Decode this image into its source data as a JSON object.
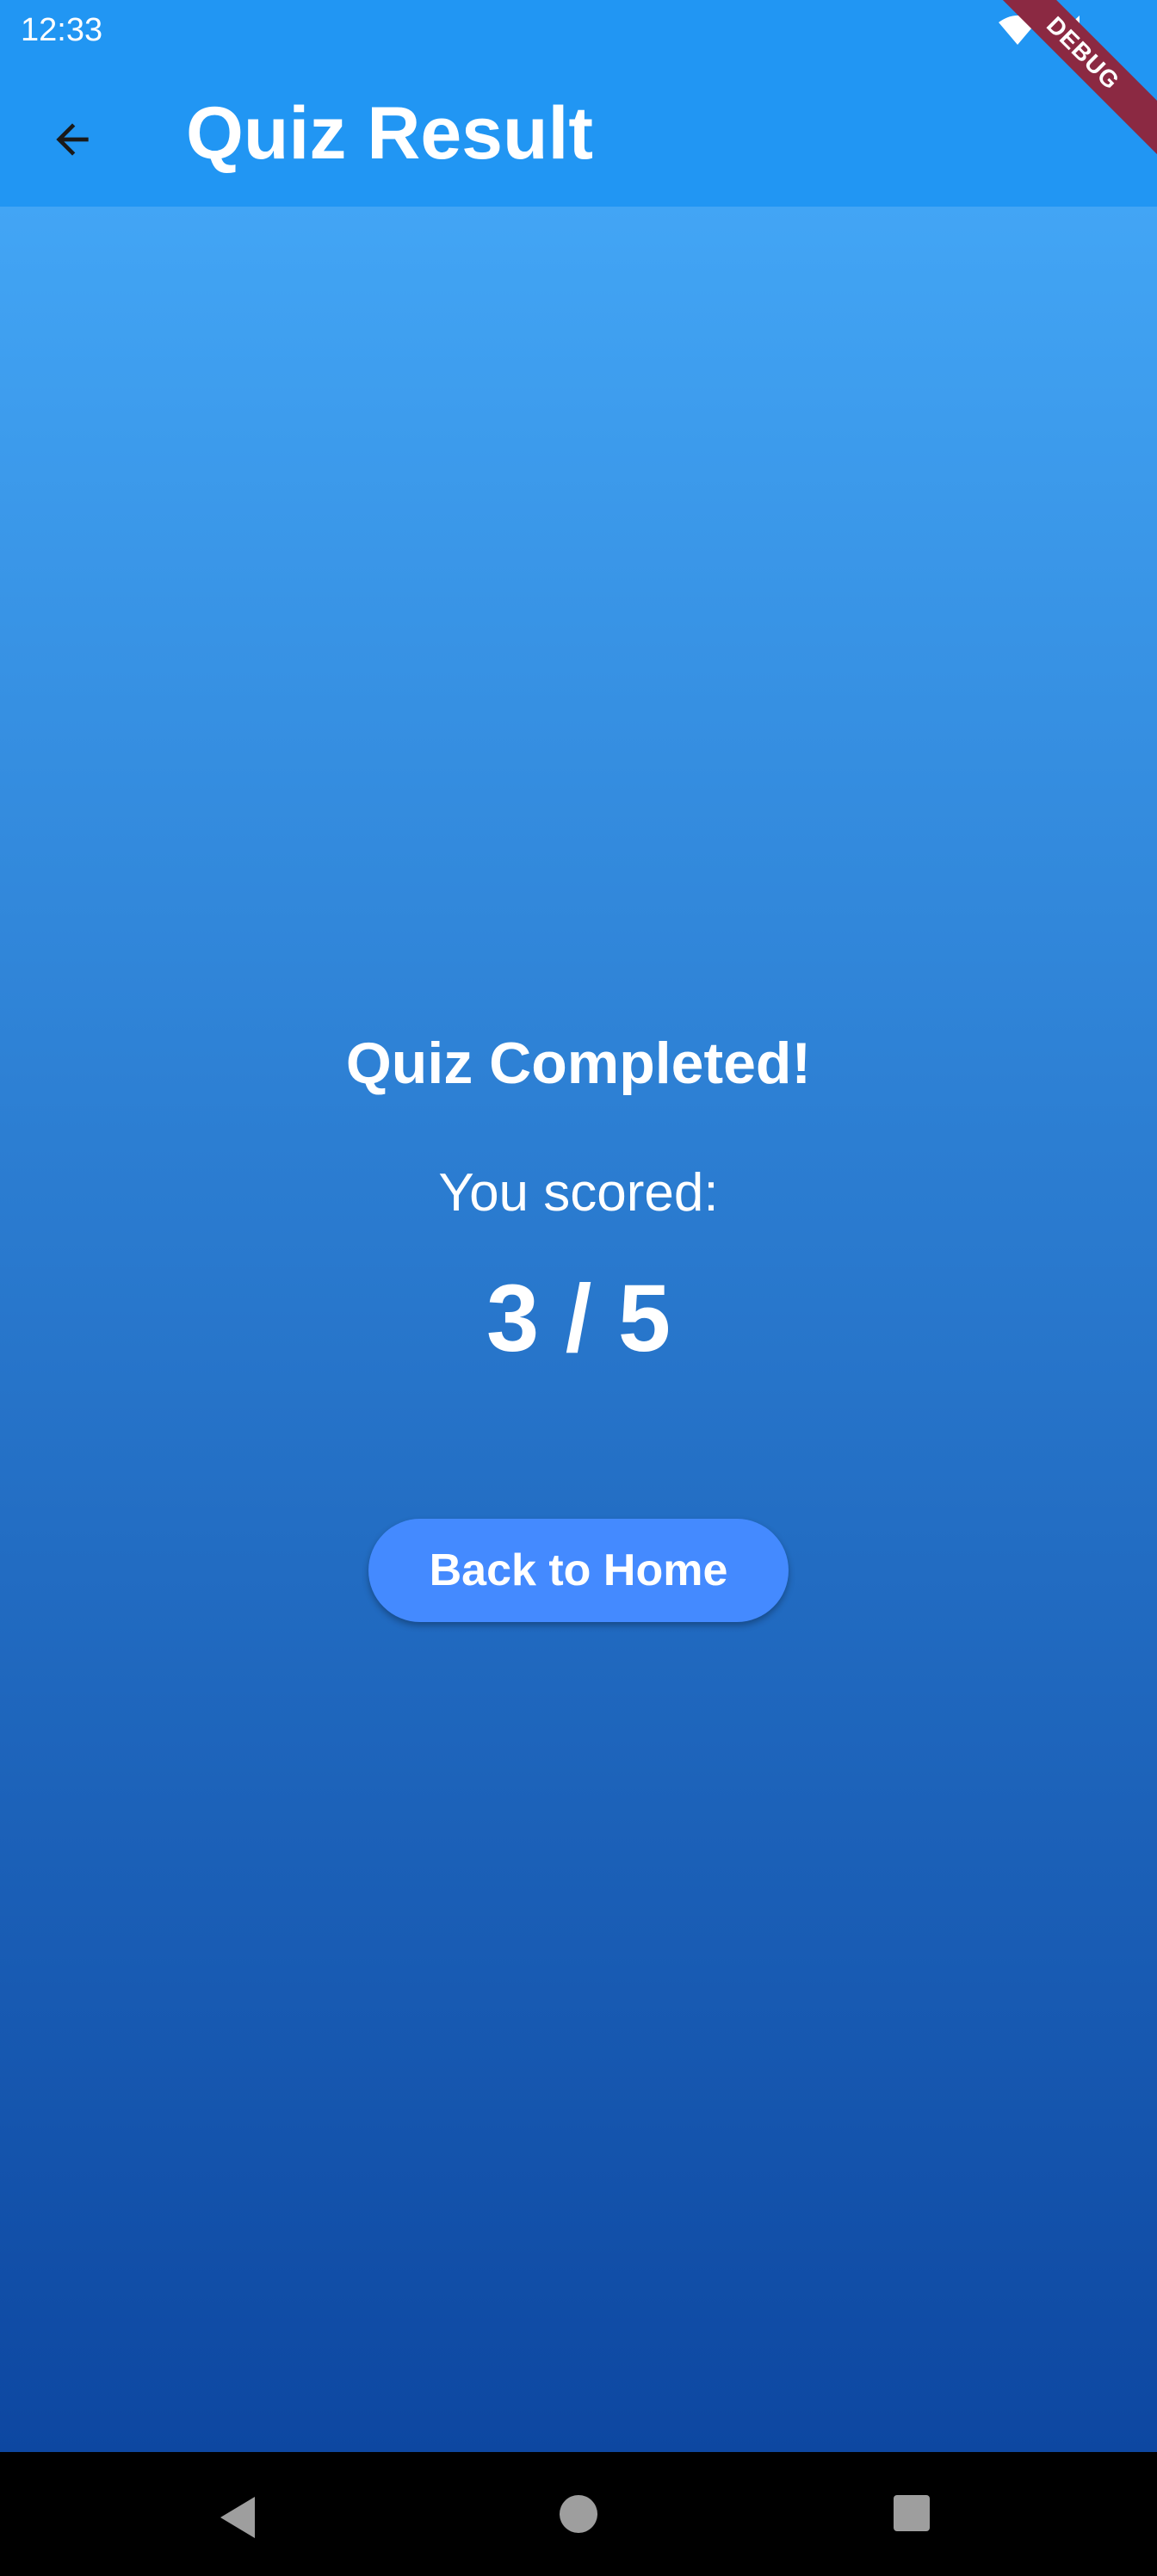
{
  "status_bar": {
    "time": "12:33",
    "icons": [
      "wifi-icon",
      "signal-icon"
    ]
  },
  "debug_banner": {
    "label": "DEBUG"
  },
  "app_bar": {
    "title": "Quiz Result",
    "back_icon": "arrow-back-icon"
  },
  "result": {
    "heading": "Quiz Completed!",
    "scored_label": "You scored:",
    "score": "3 / 5"
  },
  "actions": {
    "home_button_label": "Back to Home"
  },
  "nav_bar": {
    "icons": [
      "nav-back-icon",
      "nav-home-icon",
      "nav-recents-icon"
    ]
  },
  "colors": {
    "app_bar": "#2196F3",
    "gradient_top": "#42A5F5",
    "gradient_bottom": "#0D47A1",
    "button": "#448AFF",
    "debug_ribbon": "#8B2942"
  }
}
